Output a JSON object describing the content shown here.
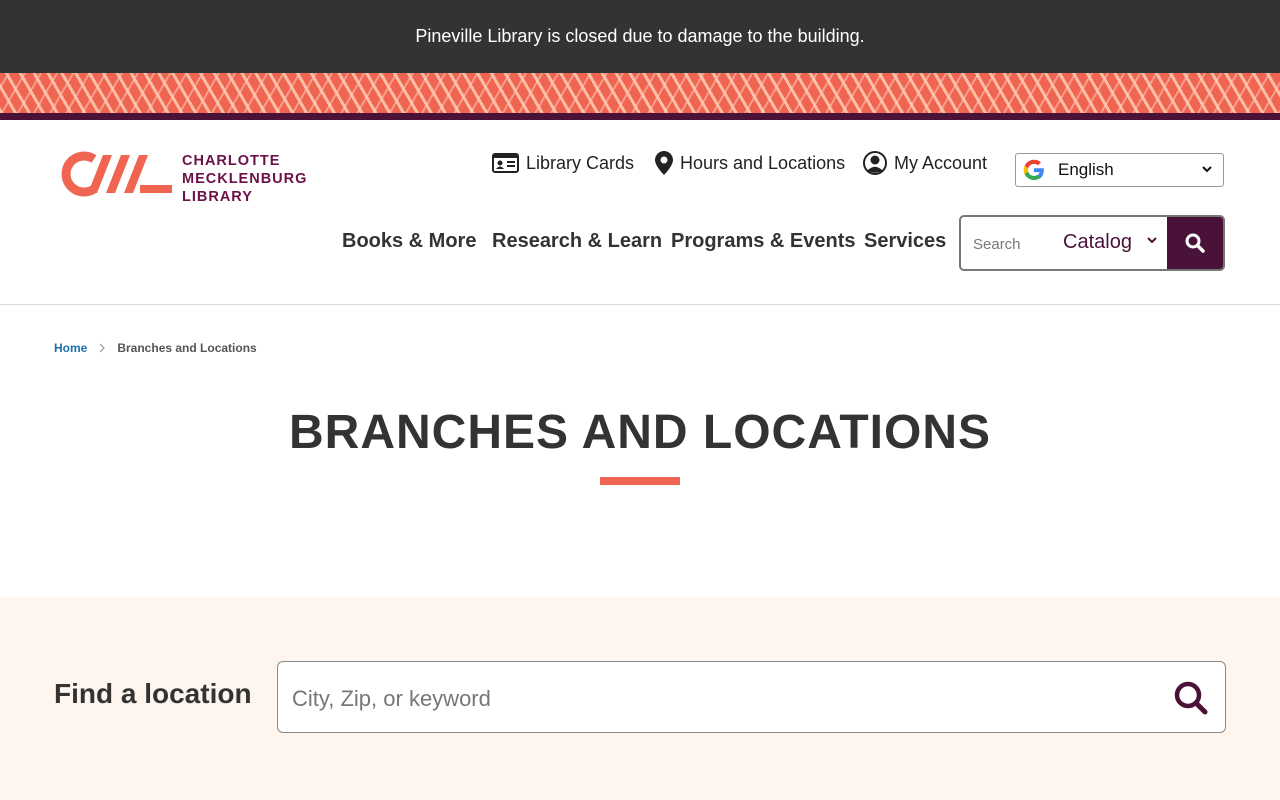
{
  "alert": {
    "text": "Pineville Library is closed due to damage to the building."
  },
  "logo": {
    "line1": "CHARLOTTE",
    "line2": "MECKLENBURG",
    "line3": "LIBRARY"
  },
  "utility_nav": {
    "library_cards": "Library Cards",
    "hours_locations": "Hours and Locations",
    "my_account": "My Account"
  },
  "language": {
    "selected": "English"
  },
  "main_nav": {
    "books": "Books & More",
    "research": "Research & Learn",
    "programs": "Programs & Events",
    "services": "Services"
  },
  "header_search": {
    "placeholder": "Search",
    "scope": "Catalog"
  },
  "breadcrumb": {
    "home": "Home",
    "current": "Branches and Locations"
  },
  "page": {
    "title": "BRANCHES AND LOCATIONS"
  },
  "find_location": {
    "label": "Find a location",
    "placeholder": "City, Zip, or keyword"
  },
  "colors": {
    "accent": "#f06552",
    "brand": "#4a1238",
    "banner": "#333333",
    "find_bg": "#fdf5ee",
    "link": "#1a6fae"
  },
  "icons": [
    "id-card-icon",
    "map-pin-icon",
    "user-circle-icon",
    "google-icon",
    "chevron-down-icon",
    "search-icon",
    "chevron-right-icon"
  ]
}
